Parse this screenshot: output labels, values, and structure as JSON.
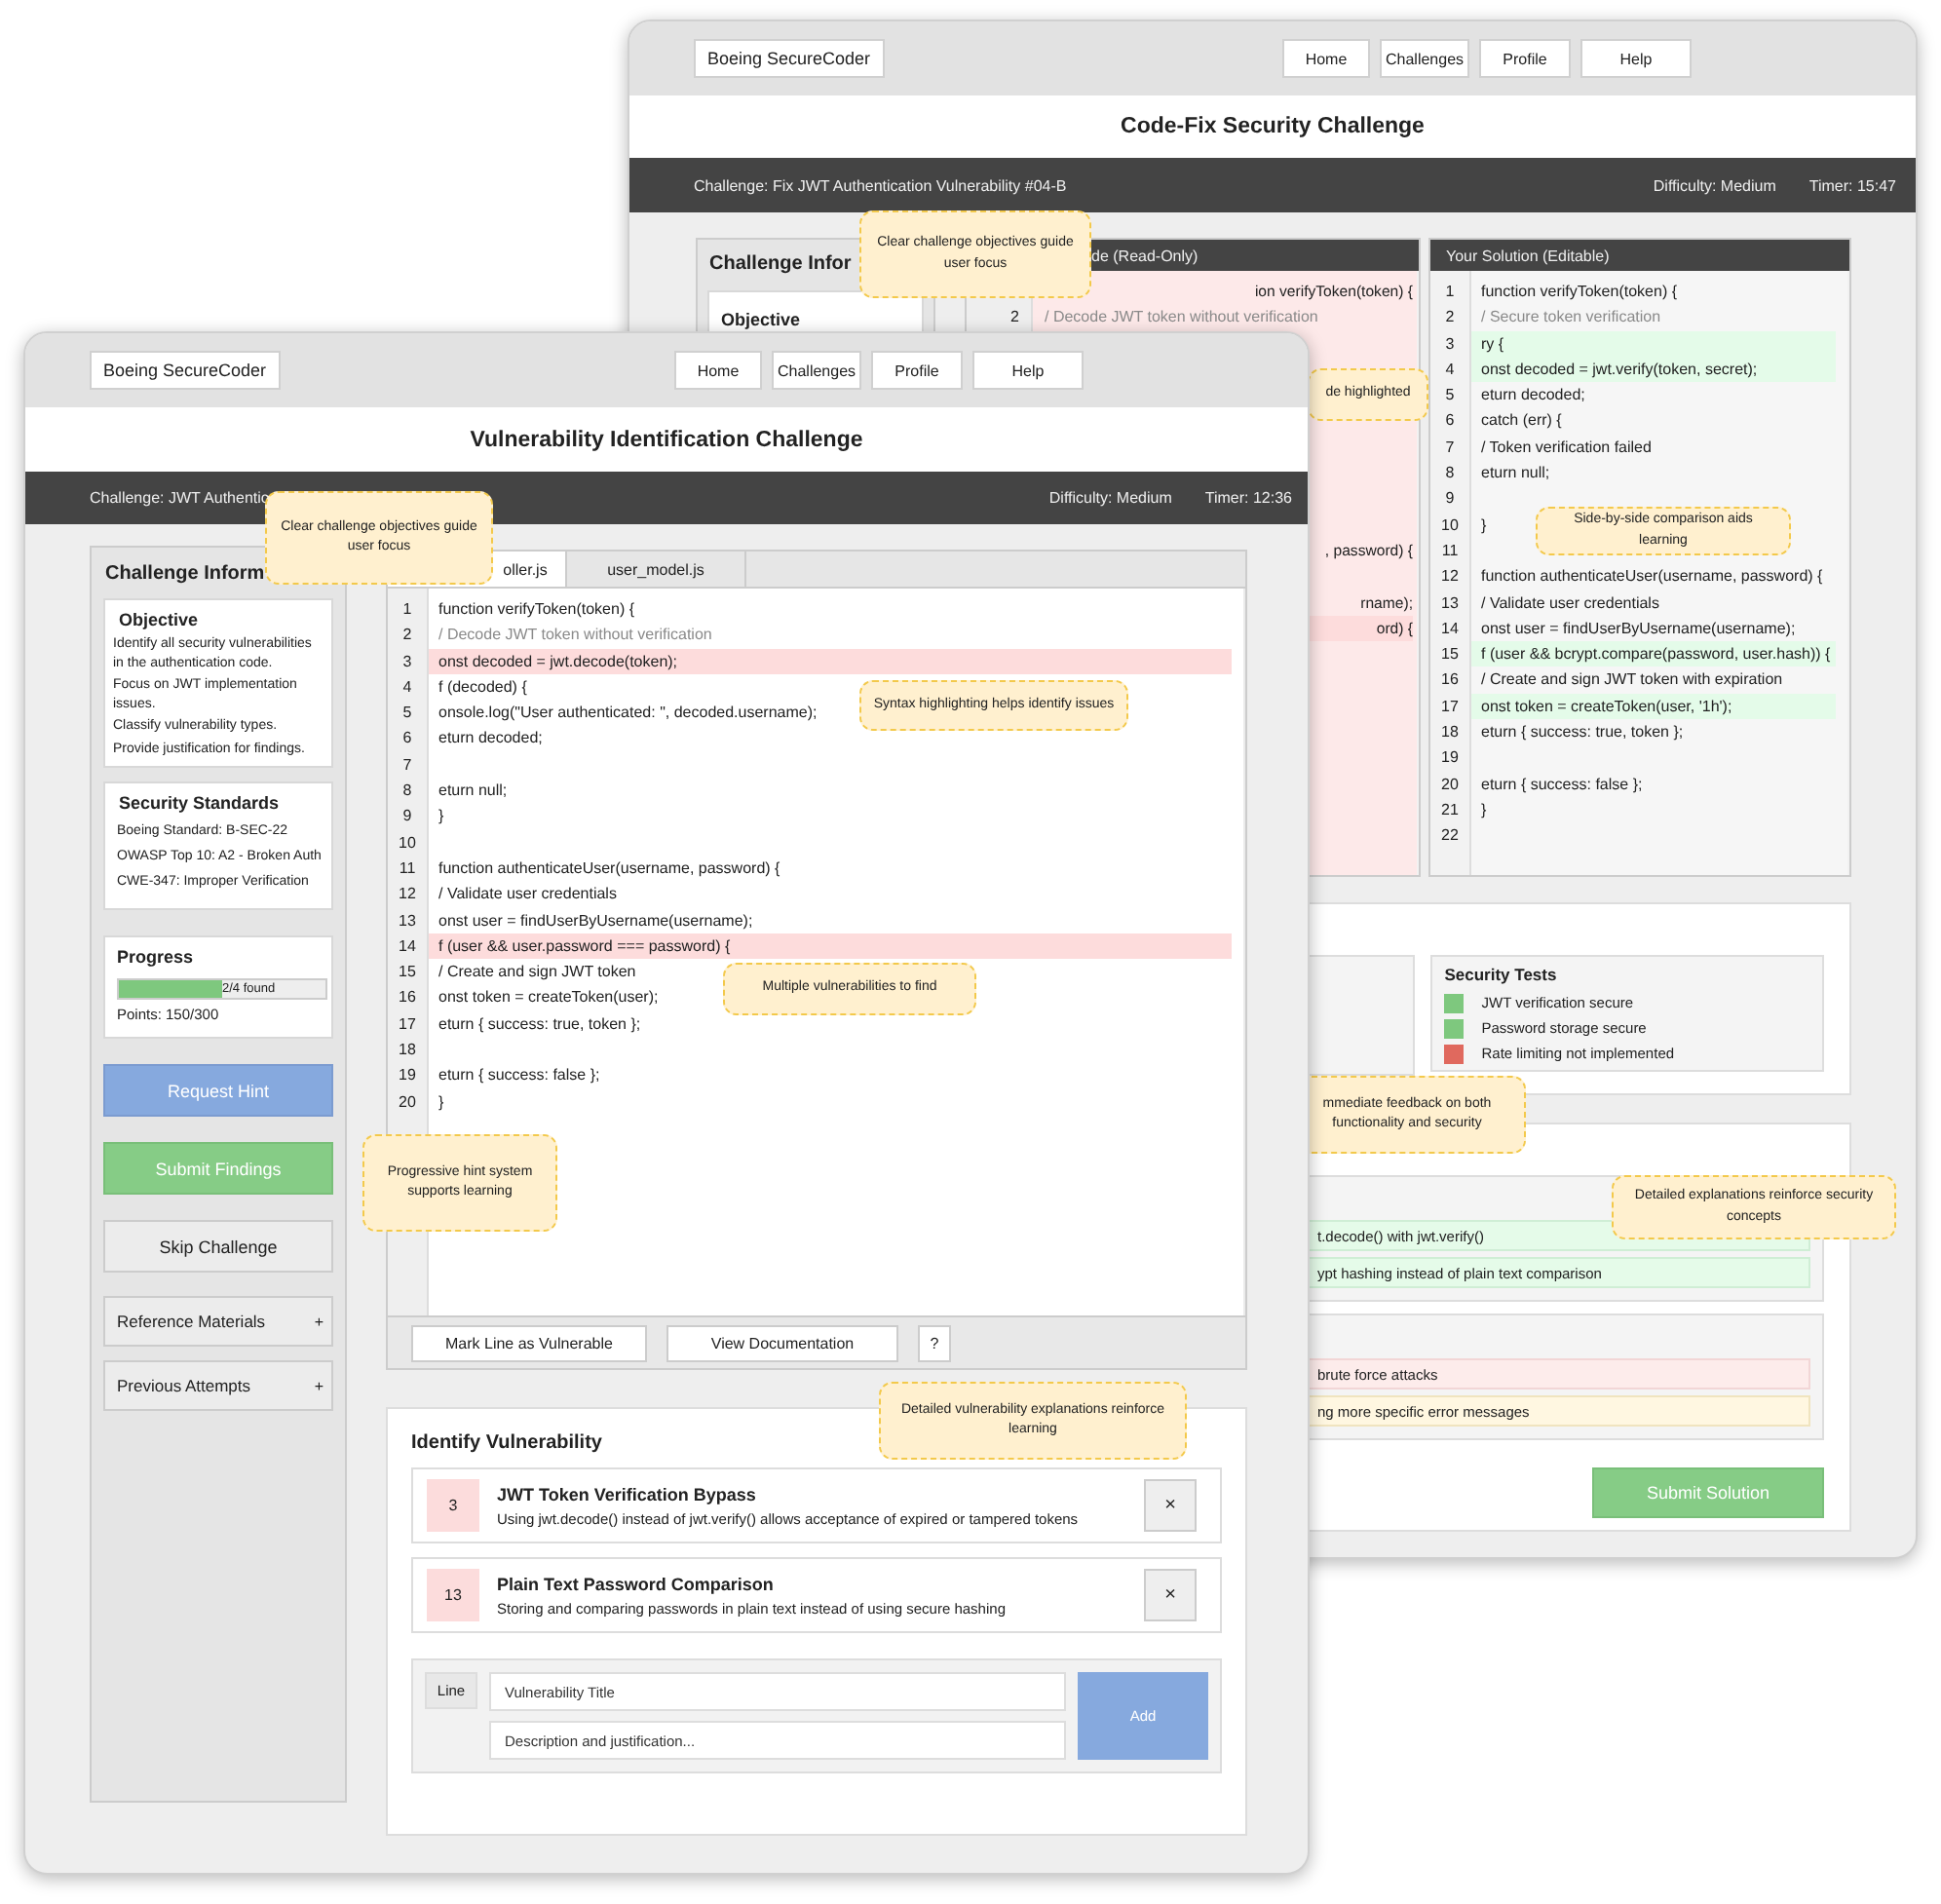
{
  "back_window": {
    "logo": "Boeing SecureCoder",
    "nav": [
      "Home",
      "Challenges",
      "Profile",
      "Help"
    ],
    "title": "Code-Fix Security Challenge",
    "challenge_bar": {
      "challenge": "Challenge: Fix JWT Authentication Vulnerability #04-B",
      "difficulty": "Difficulty: Medium",
      "timer": "Timer: 15:47"
    },
    "info_panel": {
      "title": "Challenge Infor",
      "objective_title": "Objective"
    },
    "original_code": {
      "header": "de (Read-Only)",
      "lines": [
        {
          "text": "ion verifyToken(token) {",
          "cut": true
        },
        {
          "n": "2",
          "text": "/ Decode JWT token without verification",
          "muted": true
        }
      ],
      "cut_lines": [
        {
          "text": ", password) {"
        },
        {
          "text": "rname);"
        },
        {
          "text": "ord) {",
          "flagged": true
        }
      ]
    },
    "solution_code": {
      "header": "Your Solution (Editable)",
      "lines": [
        {
          "n": "1",
          "text": "function verifyToken(token) {"
        },
        {
          "n": "2",
          "text": "/ Secure token verification",
          "muted": true
        },
        {
          "n": "3",
          "text": "ry {",
          "fixed": true
        },
        {
          "n": "4",
          "text": "onst decoded = jwt.verify(token, secret);",
          "fixed": true
        },
        {
          "n": "5",
          "text": "eturn decoded;"
        },
        {
          "n": "6",
          "text": "catch (err) {"
        },
        {
          "n": "7",
          "text": "/ Token verification failed"
        },
        {
          "n": "8",
          "text": "eturn null;"
        },
        {
          "n": "9"
        },
        {
          "n": "10",
          "text": "}"
        },
        {
          "n": "11"
        },
        {
          "n": "12",
          "text": "function authenticateUser(username, password) {"
        },
        {
          "n": "13",
          "text": "/ Validate user credentials"
        },
        {
          "n": "14",
          "text": "onst user = findUserByUsername(username);"
        },
        {
          "n": "15",
          "text": "f (user && bcrypt.compare(password, user.hash)) {",
          "fixed": true
        },
        {
          "n": "16",
          "text": "/ Create and sign JWT token with expiration"
        },
        {
          "n": "17",
          "text": "onst token = createToken(user, '1h');",
          "fixed": true
        },
        {
          "n": "18",
          "text": "eturn { success: true, token };"
        },
        {
          "n": "19"
        },
        {
          "n": "20",
          "text": "eturn { success: false };"
        },
        {
          "n": "21",
          "text": "}"
        },
        {
          "n": "22"
        }
      ]
    },
    "security_tests": {
      "title": "Security Tests",
      "items": [
        {
          "label": "JWT verification secure",
          "color": "#7ec87e"
        },
        {
          "label": "Password storage secure",
          "color": "#7ec87e"
        },
        {
          "label": "Rate limiting not implemented",
          "color": "#e0695e"
        }
      ]
    },
    "fixes": [
      {
        "text": "t.decode() with jwt.verify()",
        "kind": "good"
      },
      {
        "text": "ypt hashing instead of plain text comparison",
        "kind": "good"
      }
    ],
    "issues": [
      {
        "text": "brute force attacks",
        "kind": "bad"
      },
      {
        "text": "ng more specific error messages",
        "kind": "warn"
      }
    ],
    "submit": "Submit Solution",
    "callouts": [
      {
        "text": "Clear challenge objectives guide user focus"
      },
      {
        "text": "de highlighted"
      },
      {
        "text": "Side-by-side comparison aids learning"
      },
      {
        "text": "mmediate feedback on both functionality and security"
      },
      {
        "text": "Detailed explanations reinforce security concepts"
      }
    ]
  },
  "front_window": {
    "logo": "Boeing SecureCoder",
    "nav": [
      "Home",
      "Challenges",
      "Profile",
      "Help"
    ],
    "title": "Vulnerability Identification Challenge",
    "challenge_bar": {
      "challenge": "Challenge: JWT Authentic",
      "difficulty": "Difficulty: Medium",
      "timer": "Timer: 12:36"
    },
    "sidebar": {
      "title": "Challenge Inform",
      "objective": {
        "title": "Objective",
        "paragraphs": [
          "Identify all security vulnerabilities in the authentication code.",
          "Focus on JWT implementation issues.",
          "Classify vulnerability types.",
          "Provide justification for findings."
        ]
      },
      "standards": {
        "title": "Security Standards",
        "items": [
          "Boeing Standard: B-SEC-22",
          "OWASP Top 10: A2 - Broken Auth",
          "CWE-347: Improper Verification"
        ]
      },
      "progress": {
        "title": "Progress",
        "level": 0.5,
        "label": "2/4 found",
        "points": "Points: 150/300"
      },
      "actions": [
        {
          "label": "Request Hint",
          "kind": "primary"
        },
        {
          "label": "Submit Findings",
          "kind": "success"
        },
        {
          "label": "Skip Challenge",
          "kind": "plain"
        }
      ],
      "sections": [
        {
          "label": "Reference Materials",
          "toggle": "+"
        },
        {
          "label": "Previous Attempts",
          "toggle": "+"
        }
      ]
    },
    "code_editor": {
      "tabs": [
        {
          "label": "oller.js",
          "selected": true
        },
        {
          "label": "user_model.js",
          "selected": false
        }
      ],
      "lines": [
        {
          "n": "1",
          "text": "function verifyToken(token) {"
        },
        {
          "n": "2",
          "text": "/ Decode JWT token without verification",
          "muted": true
        },
        {
          "n": "3",
          "text": "onst decoded = jwt.decode(token);",
          "flagged": true
        },
        {
          "n": "4",
          "text": "f (decoded) {"
        },
        {
          "n": "5",
          "text": "onsole.log(\"User authenticated: \", decoded.username);"
        },
        {
          "n": "6",
          "text": "eturn decoded;"
        },
        {
          "n": "7"
        },
        {
          "n": "8",
          "text": "eturn null;"
        },
        {
          "n": "9",
          "text": "}"
        },
        {
          "n": "10"
        },
        {
          "n": "11",
          "text": "function authenticateUser(username, password) {"
        },
        {
          "n": "12",
          "text": "/ Validate user credentials"
        },
        {
          "n": "13",
          "text": "onst user = findUserByUsername(username);"
        },
        {
          "n": "14",
          "text": "f (user && user.password === password) {",
          "flagged": true
        },
        {
          "n": "15",
          "text": "/ Create and sign JWT token"
        },
        {
          "n": "16",
          "text": "onst token = createToken(user);"
        },
        {
          "n": "17",
          "text": "eturn { success: true, token };"
        },
        {
          "n": "18"
        },
        {
          "n": "19",
          "text": "eturn { success: false };"
        },
        {
          "n": "20",
          "text": "}"
        }
      ],
      "toolbar": [
        {
          "label": "Mark Line as Vulnerable",
          "kind": "text"
        },
        {
          "label": "View Documentation",
          "kind": "text"
        },
        {
          "label": "?",
          "kind": "help"
        }
      ]
    },
    "identify": {
      "title": "Identify Vulnerability",
      "findings": [
        {
          "line": "3",
          "title": "JWT Token Verification Bypass",
          "description": "Using jwt.decode() instead of jwt.verify() allows acceptance of expired or tampered tokens",
          "remove": "×"
        },
        {
          "line": "13",
          "title": "Plain Text Password Comparison",
          "description": "Storing and comparing passwords in plain text instead of using secure hashing",
          "remove": "×"
        }
      ],
      "form": {
        "line_label": "Line",
        "title_placeholder": "Vulnerability Title",
        "description_placeholder": "Description and justification...",
        "add": "Add"
      }
    },
    "callouts": [
      {
        "text": "Clear challenge objectives guide user focus"
      },
      {
        "text": "Syntax highlighting helps identify issues"
      },
      {
        "text": "Multiple vulnerabilities to find"
      },
      {
        "text": "Progressive hint system supports learning"
      },
      {
        "text": "Detailed vulnerability explanations reinforce learning"
      }
    ]
  }
}
